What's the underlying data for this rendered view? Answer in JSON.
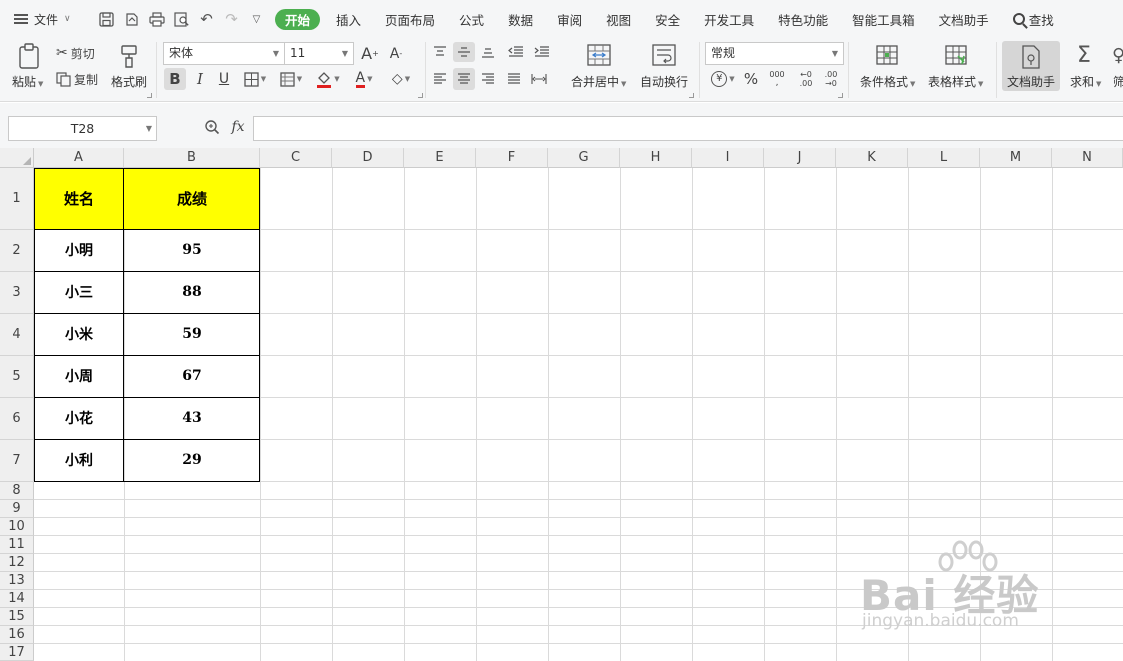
{
  "menu": {
    "file_label": "文件",
    "tabs": [
      "开始",
      "插入",
      "页面布局",
      "公式",
      "数据",
      "审阅",
      "视图",
      "安全",
      "开发工具",
      "特色功能",
      "智能工具箱",
      "文档助手"
    ],
    "search_label": "查找"
  },
  "ribbon": {
    "paste": "粘贴",
    "cut": "剪切",
    "copy": "复制",
    "format_painter": "格式刷",
    "font_name": "宋体",
    "font_size": "11",
    "bold": "B",
    "italic": "I",
    "underline": "U",
    "merge_center": "合并居中",
    "wrap_text": "自动换行",
    "number_format": "常规",
    "percent": "%",
    "thousands": "000",
    "inc_decimal": ".00",
    "dec_decimal": ".00",
    "conditional_format": "条件格式",
    "table_style": "表格样式",
    "doc_assistant": "文档助手",
    "sum": "求和",
    "more": "筛"
  },
  "formula_bar": {
    "name_box": "T28",
    "fx": "fx",
    "formula": ""
  },
  "sheet": {
    "columns": [
      "A",
      "B",
      "C",
      "D",
      "E",
      "F",
      "G",
      "H",
      "I",
      "J",
      "K",
      "L",
      "M",
      "N"
    ],
    "rows": [
      "1",
      "2",
      "3",
      "4",
      "5",
      "6",
      "7",
      "8",
      "9",
      "10",
      "11",
      "12",
      "13",
      "14",
      "15",
      "16",
      "17"
    ],
    "header": {
      "name": "姓名",
      "score": "成绩"
    },
    "records": [
      {
        "name": "小明",
        "score": "95"
      },
      {
        "name": "小三",
        "score": "88"
      },
      {
        "name": "小米",
        "score": "59"
      },
      {
        "name": "小周",
        "score": "67"
      },
      {
        "name": "小花",
        "score": "43"
      },
      {
        "name": "小利",
        "score": "29"
      }
    ],
    "header_fill": "#ffff00"
  },
  "watermark": {
    "main": "Bai  经验",
    "sub": "jingyan.baidu.com"
  }
}
